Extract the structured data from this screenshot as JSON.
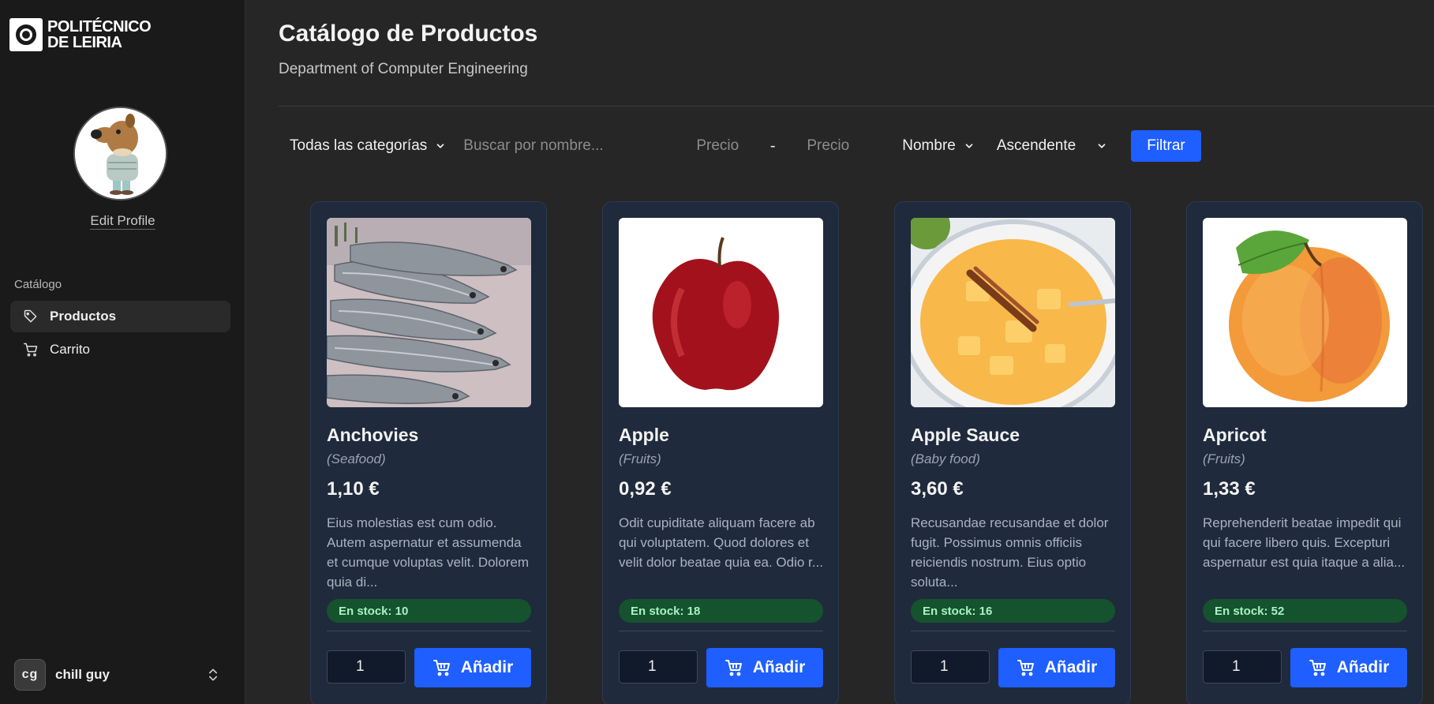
{
  "brand": {
    "line1": "POLITÉCNICO",
    "line2": "DE LEIRIA"
  },
  "profile": {
    "edit_label": "Edit Profile"
  },
  "nav": {
    "section": "Catálogo",
    "items": [
      {
        "label": "Productos",
        "icon": "tag-icon",
        "active": true
      },
      {
        "label": "Carrito",
        "icon": "cart-icon",
        "active": false
      }
    ]
  },
  "user": {
    "initials": "cg",
    "name": "chill guy"
  },
  "header": {
    "title": "Catálogo de Productos",
    "subtitle": "Department of Computer Engineering"
  },
  "filters": {
    "category": "Todas las categorías",
    "search_placeholder": "Buscar por nombre...",
    "price_min_placeholder": "Precio",
    "price_separator": "-",
    "price_max_placeholder": "Precio",
    "sort_field": "Nombre",
    "sort_order": "Ascendente",
    "filter_button": "Filtrar"
  },
  "products": [
    {
      "name": "Anchovies",
      "category": "(Seafood)",
      "price": "1,10 €",
      "description": "Eius molestias est cum odio. Autem aspernatur et assumenda et cumque voluptas velit. Dolorem quia di...",
      "stock": "En stock: 10",
      "qty": "1",
      "add_label": "Añadir"
    },
    {
      "name": "Apple",
      "category": "(Fruits)",
      "price": "0,92 €",
      "description": "Odit cupiditate aliquam facere ab qui voluptatem. Quod dolores et velit dolor beatae quia ea. Odio r...",
      "stock": "En stock: 18",
      "qty": "1",
      "add_label": "Añadir"
    },
    {
      "name": "Apple Sauce",
      "category": "(Baby food)",
      "price": "3,60 €",
      "description": "Recusandae recusandae et dolor fugit. Possimus omnis officiis reiciendis nostrum. Eius optio soluta...",
      "stock": "En stock: 16",
      "qty": "1",
      "add_label": "Añadir"
    },
    {
      "name": "Apricot",
      "category": "(Fruits)",
      "price": "1,33 €",
      "description": "Reprehenderit beatae impedit qui qui facere libero quis. Excepturi aspernatur est quia itaque a alia...",
      "stock": "En stock: 52",
      "qty": "1",
      "add_label": "Añadir"
    }
  ],
  "colors": {
    "accent": "#1f5eff",
    "stock_bg": "#14532d",
    "card_bg": "#1f2a3c",
    "sidebar_bg": "#1a1a1a"
  }
}
